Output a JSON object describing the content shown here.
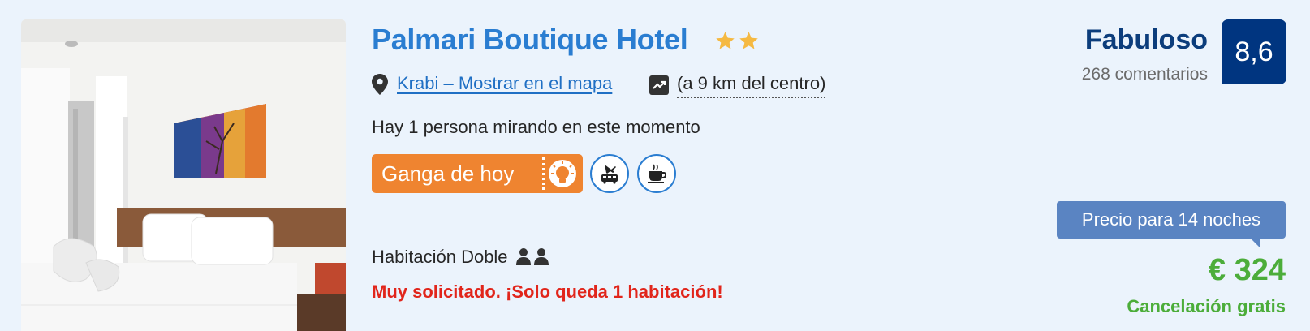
{
  "hotel": {
    "name": "Palmari Boutique Hotel",
    "stars": 2,
    "location_link": "Krabi – Mostrar en el mapa",
    "distance": "(a 9 km del centro)",
    "watching": "Hay 1 persona mirando en este momento"
  },
  "badges": {
    "deal_label": "Ganga de hoy",
    "icons": [
      "deal-lightbulb-icon",
      "airport-shuttle-icon",
      "coffee-icon"
    ]
  },
  "room": {
    "type": "Habitación Doble",
    "occupancy_icon": "two-persons-icon",
    "urgency": "Muy solicitado. ¡Solo queda 1 habitación!"
  },
  "rating": {
    "word": "Fabuloso",
    "reviews": "268 comentarios",
    "score": "8,6"
  },
  "price": {
    "label": "Precio para 14 noches",
    "amount": "€ 324",
    "cancellation": "Cancelación gratis"
  },
  "colors": {
    "background": "#ebf3fc",
    "link_blue": "#2a7dd1",
    "score_bg": "#003580",
    "deal_orange": "#ef8430",
    "green": "#4cad3a",
    "urgent_red": "#e1251b",
    "star": "#f5b942"
  }
}
